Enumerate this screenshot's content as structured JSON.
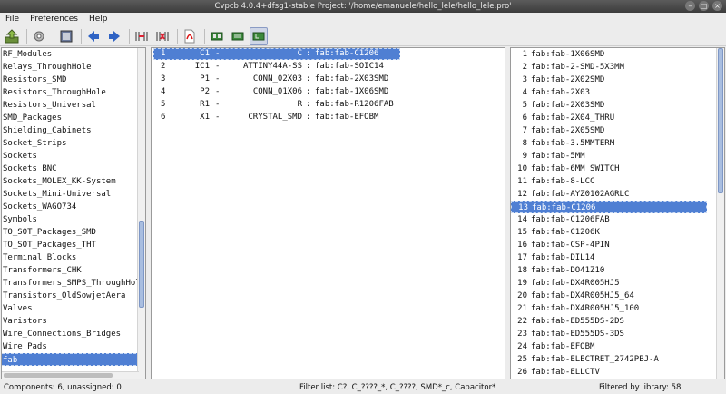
{
  "window": {
    "title": "Cvpcb 4.0.4+dfsg1-stable  Project: '/home/emanuele/hello_lele/hello_lele.pro'"
  },
  "menu": [
    "File",
    "Preferences",
    "Help"
  ],
  "toolbar": {
    "icons": [
      "save-netlist-icon",
      "settings-icon",
      "footprint-libs-icon",
      "previous-icon",
      "next-icon",
      "auto-associate-icon",
      "delete-association-icon",
      "pdf-doc-icon",
      "filter-keyword-icon",
      "filter-pincount-icon",
      "filter-library-icon"
    ]
  },
  "libraries": [
    "RF_Modules",
    "Relays_ThroughHole",
    "Resistors_SMD",
    "Resistors_ThroughHole",
    "Resistors_Universal",
    "SMD_Packages",
    "Shielding_Cabinets",
    "Socket_Strips",
    "Sockets",
    "Sockets_BNC",
    "Sockets_MOLEX_KK-System",
    "Sockets_Mini-Universal",
    "Sockets_WAGO734",
    "Symbols",
    "TO_SOT_Packages_SMD",
    "TO_SOT_Packages_THT",
    "Terminal_Blocks",
    "Transformers_CHK",
    "Transformers_SMPS_ThroughHole",
    "Transistors_OldSowjetAera",
    "Valves",
    "Varistors",
    "Wire_Connections_Bridges",
    "Wire_Pads",
    "fab"
  ],
  "libraries_selected": 24,
  "libraries_scroll": {
    "thumb_fraction": 0.27,
    "thumb_position": 0.73
  },
  "components": [
    {
      "idx": "1",
      "ref": "C1",
      "value": "C",
      "footprint": "fab:fab-C1206"
    },
    {
      "idx": "2",
      "ref": "IC1",
      "value": "ATTINY44A-SS",
      "footprint": "fab:fab-SOIC14"
    },
    {
      "idx": "3",
      "ref": "P1",
      "value": "CONN_02X03",
      "footprint": "fab:fab-2X03SMD"
    },
    {
      "idx": "4",
      "ref": "P2",
      "value": "CONN_01X06",
      "footprint": "fab:fab-1X06SMD"
    },
    {
      "idx": "5",
      "ref": "R1",
      "value": "R",
      "footprint": "fab:fab-R1206FAB"
    },
    {
      "idx": "6",
      "ref": "X1",
      "value": "CRYSTAL_SMD",
      "footprint": "fab:fab-EFOBM"
    }
  ],
  "components_selected": 0,
  "sep_dash": "-",
  "sep_colon": ":",
  "footprints": [
    "fab:fab-1X06SMD",
    "fab:fab-2-SMD-5X3MM",
    "fab:fab-2X02SMD",
    "fab:fab-2X03",
    "fab:fab-2X03SMD",
    "fab:fab-2X04_THRU",
    "fab:fab-2X05SMD",
    "fab:fab-3.5MMTERM",
    "fab:fab-5MM",
    "fab:fab-6MM_SWITCH",
    "fab:fab-8-LCC",
    "fab:fab-AYZ0102AGRLC",
    "fab:fab-C1206",
    "fab:fab-C1206FAB",
    "fab:fab-C1206K",
    "fab:fab-CSP-4PIN",
    "fab:fab-DIL14",
    "fab:fab-DO41Z10",
    "fab:fab-DX4R005HJ5",
    "fab:fab-DX4R005HJ5_64",
    "fab:fab-DX4R005HJ5_100",
    "fab:fab-ED555DS-2DS",
    "fab:fab-ED555DS-3DS",
    "fab:fab-EFOBM",
    "fab:fab-ELECTRET_2742PBJ-A",
    "fab:fab-ELLCTV"
  ],
  "footprints_selected": 12,
  "footprints_scroll": {
    "thumb_fraction": 0.44,
    "thumb_position": 0.0
  },
  "status": {
    "left": "Components: 6, unassigned: 0",
    "middle": "Filter list: C?, C_????_*, C_????, SMD*_c, Capacitor*",
    "right": "Filtered by library: 58"
  }
}
